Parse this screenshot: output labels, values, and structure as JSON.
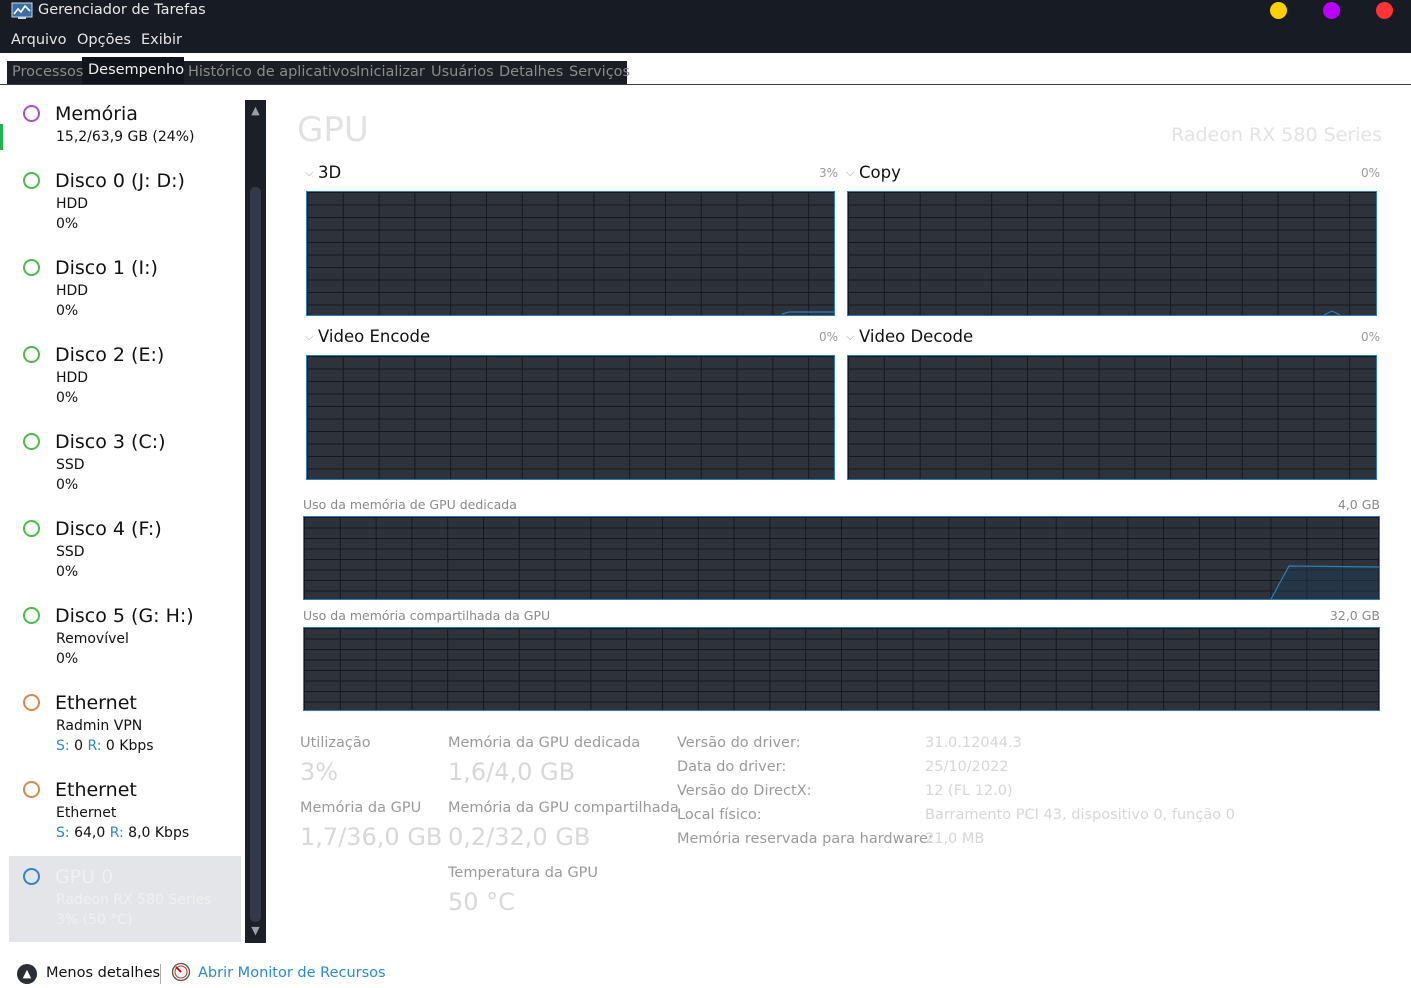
{
  "window": {
    "title": "Gerenciador de Tarefas",
    "dots": [
      "#ffd000",
      "#bb00ff",
      "#ff3434"
    ]
  },
  "menu": [
    "Arquivo",
    "Opções",
    "Exibir"
  ],
  "tabs": [
    "Processos",
    "Desempenho",
    "Histórico de aplicativos",
    "Inicializar",
    "Usuários",
    "Detalhes",
    "Serviços"
  ],
  "sidebar": {
    "items": [
      {
        "title": "Memória",
        "line1": "15,2/63,9 GB (24%)",
        "color": "#b54ac9"
      },
      {
        "title": "Disco 0 (J: D:)",
        "line1": "HDD",
        "line2": "0%",
        "color": "#4cbb4a"
      },
      {
        "title": "Disco 1 (I:)",
        "line1": "HDD",
        "line2": "0%",
        "color": "#4cbb4a"
      },
      {
        "title": "Disco 2 (E:)",
        "line1": "HDD",
        "line2": "0%",
        "color": "#4cbb4a"
      },
      {
        "title": "Disco 3 (C:)",
        "line1": "SSD",
        "line2": "0%",
        "color": "#4cbb4a"
      },
      {
        "title": "Disco 4 (F:)",
        "line1": "SSD",
        "line2": "0%",
        "color": "#4cbb4a"
      },
      {
        "title": "Disco 5 (G: H:)",
        "line1": "Removível",
        "line2": "0%",
        "color": "#4cbb4a"
      },
      {
        "title": "Ethernet",
        "line1": "Radmin VPN",
        "s_label": "S:",
        "s_value": "0",
        "r_label": "R:",
        "r_value": "0 Kbps",
        "color": "#d98a4a"
      },
      {
        "title": "Ethernet",
        "line1": "Ethernet",
        "s_label": "S:",
        "s_value": "64,0",
        "r_label": "R:",
        "r_value": "8,0 Kbps",
        "color": "#d98a4a"
      },
      {
        "title": "GPU 0",
        "line1": "Radeon RX 580 Series",
        "line2": "3% (50 °C)",
        "color": "#2e86c9"
      }
    ]
  },
  "gpu": {
    "title": "GPU",
    "model": "Radeon RX 580 Series",
    "engines": [
      {
        "name": "3D",
        "pct": "3%"
      },
      {
        "name": "Copy",
        "pct": "0%"
      },
      {
        "name": "Video Encode",
        "pct": "0%"
      },
      {
        "name": "Video Decode",
        "pct": "0%"
      }
    ],
    "dedicated_label": "Uso da memória de GPU dedicada",
    "dedicated_max": "4,0 GB",
    "shared_label": "Uso da memória compartilhada da GPU",
    "shared_max": "32,0 GB"
  },
  "stats": {
    "utilization_label": "Utilização",
    "utilization": "3%",
    "gpu_mem_label": "Memória da GPU",
    "gpu_mem": "1,7/36,0 GB",
    "dedicated_label": "Memória da GPU dedicada",
    "dedicated": "1,6/4,0 GB",
    "shared_label": "Memória da GPU compartilhada",
    "shared": "0,2/32,0 GB",
    "temp_label": "Temperatura da GPU",
    "temp": "50 °C"
  },
  "details": [
    {
      "label": "Versão do driver:",
      "value": "31.0.12044.3"
    },
    {
      "label": "Data do driver:",
      "value": "25/10/2022"
    },
    {
      "label": "Versão do DirectX:",
      "value": "12 (FL 12.0)"
    },
    {
      "label": "Local físico:",
      "value": "Barramento PCI 43, dispositivo 0, função 0"
    },
    {
      "label": "Memória reservada para hardware:",
      "value": "21,0 MB"
    }
  ],
  "footer": {
    "fewer_details": "Menos detalhes",
    "open_monitor": "Abrir Monitor de Recursos"
  }
}
